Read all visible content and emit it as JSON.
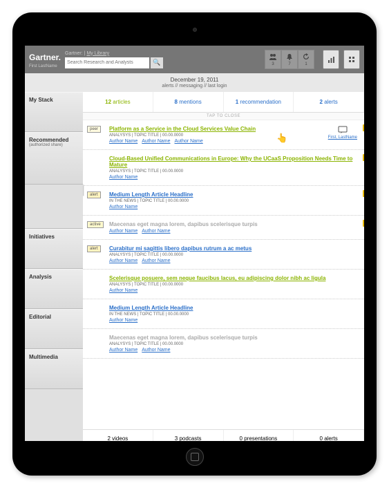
{
  "header": {
    "brand": "Gartner.",
    "brand_sub": "First LastName",
    "crumb_prefix": "Gartner:",
    "crumb_link": "My Library",
    "search_placeholder": "Search Research and Analysts",
    "icons": [
      {
        "glyph": "people",
        "count": "3"
      },
      {
        "glyph": "bell",
        "count": "7"
      },
      {
        "glyph": "refresh",
        "count": "1"
      }
    ]
  },
  "datebar": {
    "date": "December 19, 2011",
    "links": "alerts  //  messaging  //  last login"
  },
  "sidebar": [
    {
      "label": "My Stack",
      "sub": ""
    },
    {
      "label": "Recommended",
      "sub": "(authorized share)"
    },
    {
      "label": "Initiatives",
      "sub": ""
    },
    {
      "label": "Analysis",
      "sub": ""
    },
    {
      "label": "Editorial",
      "sub": ""
    },
    {
      "label": "Multimedia",
      "sub": ""
    }
  ],
  "tabs": [
    {
      "count": "12",
      "label": "articles",
      "cls": "green"
    },
    {
      "count": "8",
      "label": "mentions",
      "cls": "blue"
    },
    {
      "count": "1",
      "label": "recommendation",
      "cls": "blue"
    },
    {
      "count": "2",
      "label": "alerts",
      "cls": "blue"
    }
  ],
  "tap_close": "TAP TO CLOSE",
  "articles": [
    {
      "badge": "peer",
      "title": "Platform as a Service in the Cloud Services Value Chain",
      "title_cls": "green",
      "meta": "ANALYSYS  |  TOPIC TITLE  |  00.00.0000",
      "authors": [
        "Author Name",
        "Author Name",
        "Author Name"
      ],
      "sidelink": "First, LastName",
      "hand": true
    },
    {
      "badge": "",
      "title": "Cloud-Based Unified Communications in Europe: Why the UCaaS Proposition Needs Time to Mature",
      "title_cls": "green",
      "meta": "ANALYSYS  |  TOPIC TITLE  |  00.00.0000",
      "authors": [
        "Author Name"
      ]
    },
    {
      "badge": "alert",
      "title": "Medium Length Article Headline",
      "title_cls": "blue",
      "meta": "IN THE NEWS  |  TOPIC TITLE  |  00.00.0000",
      "authors": [
        "Author Name"
      ]
    },
    {
      "badge": "active",
      "title": "Maecenas eget magna lorem, dapibus scelerisque turpis",
      "title_cls": "grey",
      "meta": "",
      "authors": [
        "Author Name",
        "Author Name"
      ]
    },
    {
      "badge": "alert",
      "title": "Curabitur mi sagittis libero dapibus rutrum a ac metus",
      "title_cls": "blue",
      "meta": "ANALYSYS  |  TOPIC TITLE  |  00.00.0000",
      "authors": [
        "Author Name",
        "Author Name"
      ]
    },
    {
      "badge": "",
      "title": "Scelerisque posuere, sem neque faucibus lacus, eu adipiscing dolor nibh ac ligula",
      "title_cls": "green",
      "meta": "ANALYSYS  |  TOPIC TITLE  |  00.00.0000",
      "authors": [
        "Author Name"
      ]
    },
    {
      "badge": "",
      "title": "Medium Length Article Headline",
      "title_cls": "blue",
      "meta": "IN THE NEWS  |  TOPIC TITLE  |  00.00.0000",
      "authors": [
        "Author Name"
      ]
    },
    {
      "badge": "",
      "title": "Maecenas eget magna lorem, dapibus scelerisque turpis",
      "title_cls": "grey",
      "meta": "ANALYSYS  |  TOPIC TITLE  |  00.00.0000",
      "authors": [
        "Author Name",
        "Author Name"
      ]
    }
  ],
  "bottom_tabs": [
    {
      "count": "2",
      "label": "videos",
      "cls": "green"
    },
    {
      "count": "3",
      "label": "podcasts",
      "cls": "blue"
    },
    {
      "count": "0",
      "label": "presentations",
      "cls": "grey"
    },
    {
      "count": "0",
      "label": "alerts",
      "cls": "grey"
    }
  ]
}
